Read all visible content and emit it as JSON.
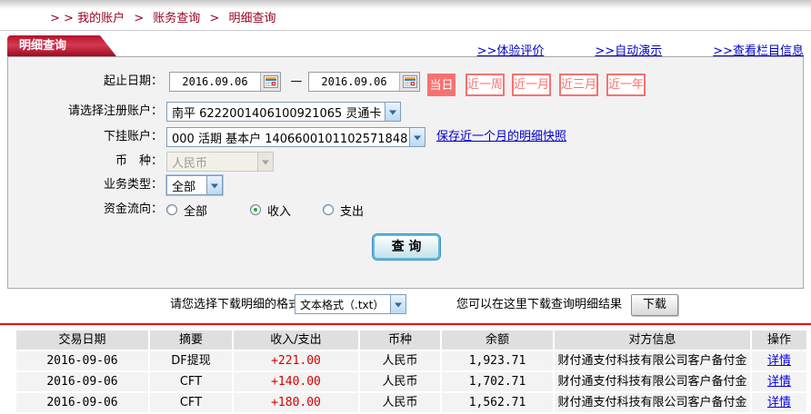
{
  "breadcrumb": {
    "prefix": "> >",
    "sep": ">",
    "items": [
      "我的账户",
      "账务查询",
      "明细查询"
    ]
  },
  "header": {
    "tab": "明细查询",
    "links": [
      ">>体验评价",
      ">>自动演示",
      ">>查看栏目信息"
    ]
  },
  "form": {
    "date_label": "起止日期：",
    "date_from": "2016.09.06",
    "date_to": "2016.09.06",
    "date_dash": "—",
    "quick": {
      "active": "当日",
      "others": [
        "近一周",
        "近一月",
        "近三月",
        "近一年"
      ]
    },
    "register_label": "请选择注册账户：",
    "register_value": "南平 6222001406100921065 灵通卡",
    "sub_label": "下挂账户：",
    "sub_value": "000 活期 基本户 1406600101102571848",
    "snapshot_link": "保存近一个月的明细快照",
    "currency_label": "币　种：",
    "currency_value": "人民币",
    "biz_label": "业务类型：",
    "biz_value": "全部",
    "flow_label": "资金流向：",
    "flow": {
      "options": [
        {
          "label": "全部",
          "checked": false
        },
        {
          "label": "收入",
          "checked": true
        },
        {
          "label": "支出",
          "checked": false
        }
      ]
    },
    "query_button": "查 询"
  },
  "download": {
    "format_label": "请您选择下载明细的格式",
    "format_value": "文本格式（.txt）",
    "hint": "您可以在这里下载查询明细结果",
    "button": "下载"
  },
  "table": {
    "headers": [
      "交易日期",
      "摘要",
      "收入/支出",
      "币种",
      "余额",
      "对方信息",
      "操作"
    ],
    "rows": [
      {
        "date": "2016-09-06",
        "summary": "DF提现",
        "amount": "+221.00",
        "currency": "人民币",
        "balance": "1,923.71",
        "counterparty": "财付通支付科技有限公司客户备付金",
        "action": "详情"
      },
      {
        "date": "2016-09-06",
        "summary": "CFT",
        "amount": "+140.00",
        "currency": "人民币",
        "balance": "1,702.71",
        "counterparty": "财付通支付科技有限公司客户备付金",
        "action": "详情"
      },
      {
        "date": "2016-09-06",
        "summary": "CFT",
        "amount": "+180.00",
        "currency": "人民币",
        "balance": "1,562.71",
        "counterparty": "财付通支付科技有限公司客户备付金",
        "action": "详情"
      }
    ]
  },
  "colors": {
    "accent_red": "#c41230",
    "quick_button_red": "#f87171",
    "link_blue": "#0000cc",
    "amount_red": "#d40000",
    "separator_red": "#f20d0d",
    "panel_gray": "#f2f2f2"
  }
}
